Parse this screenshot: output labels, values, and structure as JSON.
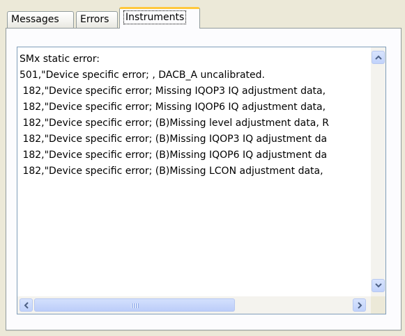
{
  "tabs": [
    {
      "label": "Messages",
      "active": false
    },
    {
      "label": "Errors",
      "active": false
    },
    {
      "label": "Instruments",
      "active": true
    }
  ],
  "textbox": {
    "lines": [
      "SMx static error:",
      "501,\"Device specific error; , DACB_A uncalibrated.",
      " 182,\"Device specific error; Missing IQOP3 IQ adjustment data,",
      " 182,\"Device specific error; Missing IQOP6 IQ adjustment data,",
      " 182,\"Device specific error; (B)Missing level adjustment data, R",
      " 182,\"Device specific error; (B)Missing IQOP3 IQ adjustment da",
      " 182,\"Device specific error; (B)Missing IQOP6 IQ adjustment da",
      " 182,\"Device specific error; (B)Missing LCON adjustment data,"
    ]
  },
  "icons": {
    "scroll_up": "up-arrow-icon",
    "scroll_down": "down-arrow-icon",
    "scroll_left": "left-arrow-icon",
    "scroll_right": "right-arrow-icon"
  },
  "colors": {
    "window_bg": "#ece9d8",
    "tab_highlight": "#ffc83c",
    "textbox_border": "#7f9db9",
    "scroll_button": "#c1d3fb",
    "arrow": "#4d6185"
  }
}
